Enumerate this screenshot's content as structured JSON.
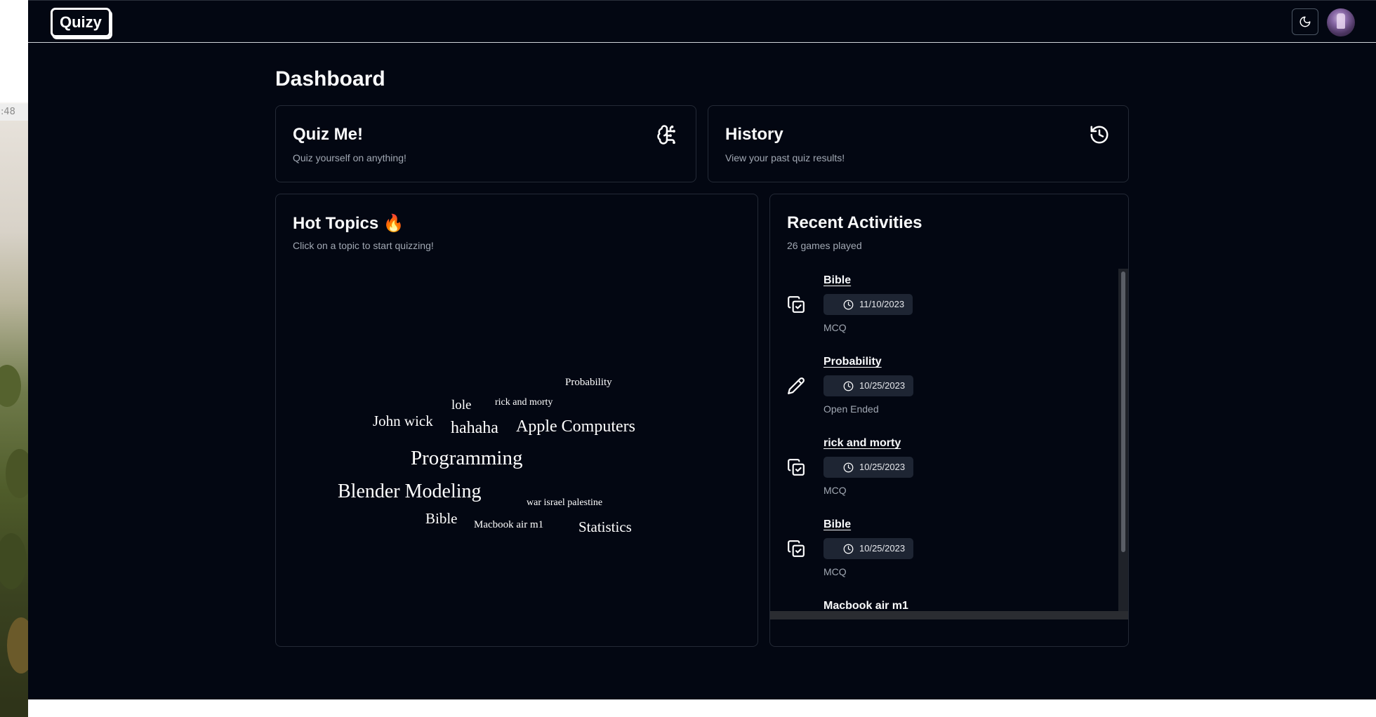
{
  "desktop": {
    "clock_fragment": ":48"
  },
  "header": {
    "logo": "Quizy",
    "theme_icon": "moon-icon",
    "avatar_icon": "user-avatar"
  },
  "page": {
    "title": "Dashboard"
  },
  "cards": {
    "quiz_me": {
      "title": "Quiz Me!",
      "subtitle": "Quiz yourself on anything!",
      "icon": "brain-icon"
    },
    "history": {
      "title": "History",
      "subtitle": "View your past quiz results!",
      "icon": "history-icon"
    }
  },
  "hot_topics": {
    "title": "Hot Topics 🔥",
    "subtitle": "Click on a topic to start quizzing!",
    "words": [
      "Probability",
      "lole",
      "rick and morty",
      "John wick",
      "hahaha",
      "Apple Computers",
      "Programming",
      "Blender Modeling",
      "war israel palestine",
      "Bible",
      "Macbook air m1",
      "Statistics"
    ]
  },
  "recent": {
    "title": "Recent Activities",
    "subtitle": "26 games played",
    "items": [
      {
        "title": "Bible",
        "date": "11/10/2023",
        "type": "MCQ",
        "icon": "copy-check-icon"
      },
      {
        "title": "Probability",
        "date": "10/25/2023",
        "type": "Open Ended",
        "icon": "pencil-icon"
      },
      {
        "title": "rick and morty",
        "date": "10/25/2023",
        "type": "MCQ",
        "icon": "copy-check-icon"
      },
      {
        "title": "Bible",
        "date": "10/25/2023",
        "type": "MCQ",
        "icon": "copy-check-icon"
      },
      {
        "title": "Macbook air m1",
        "date": "",
        "type": "",
        "icon": "copy-check-icon"
      }
    ]
  }
}
